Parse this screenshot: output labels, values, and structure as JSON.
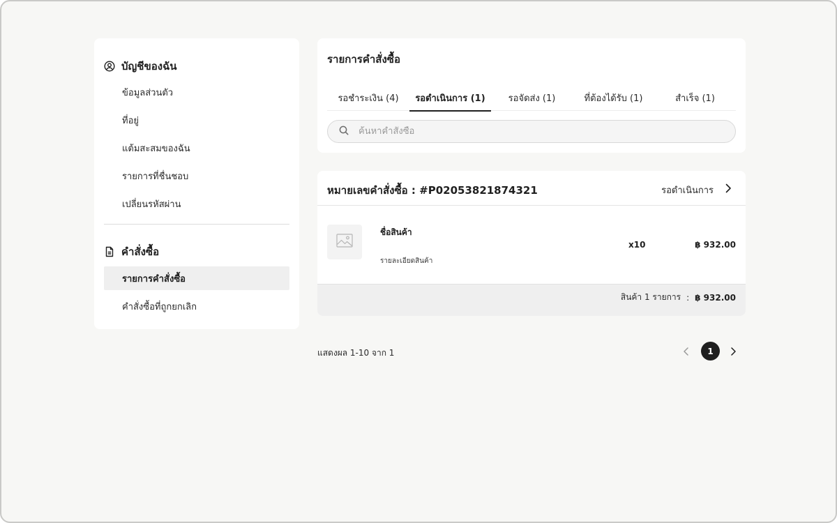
{
  "sidebar": {
    "account_heading": "บัญชีของฉัน",
    "account_items": [
      {
        "label": "ข้อมูลส่วนตัว"
      },
      {
        "label": "ที่อยู่"
      },
      {
        "label": "แต้มสะสมของฉัน"
      },
      {
        "label": "รายการที่ชื่นชอบ"
      },
      {
        "label": "เปลี่ยนรหัสผ่าน"
      }
    ],
    "orders_heading": "คำสั่งซื้อ",
    "order_items": [
      {
        "label": "รายการคำสั่งซื้อ",
        "active": true
      },
      {
        "label": "คำสั่งซื้อที่ถูกยกเลิก",
        "active": false
      }
    ]
  },
  "orders": {
    "title": "รายการคำสั่งซื้อ",
    "tabs": [
      {
        "label": "รอชำระเงิน (4)"
      },
      {
        "label": "รอดำเนินการ (1)",
        "active": true
      },
      {
        "label": "รอจัดส่ง (1)"
      },
      {
        "label": "ที่ต้องได้รับ (1)"
      },
      {
        "label": "สำเร็จ (1)"
      }
    ],
    "search_placeholder": "ค้นหาคำสั่งซื้อ"
  },
  "order": {
    "number": "หมายเลขคำสั่งซื้อ : #P02053821874321",
    "status": "รอดำเนินการ",
    "product": {
      "name": "ชื่อสินค้า",
      "description": "รายละเอียดสินค้า",
      "quantity": "x10",
      "price": "฿ 932.00"
    },
    "summary": {
      "count_label": "สินค้า 1 รายการ",
      "separator": ":",
      "total": "฿ 932.00"
    }
  },
  "pagination": {
    "results_text": "แสดงผล 1-10 จาก 1",
    "current_page": "1"
  }
}
